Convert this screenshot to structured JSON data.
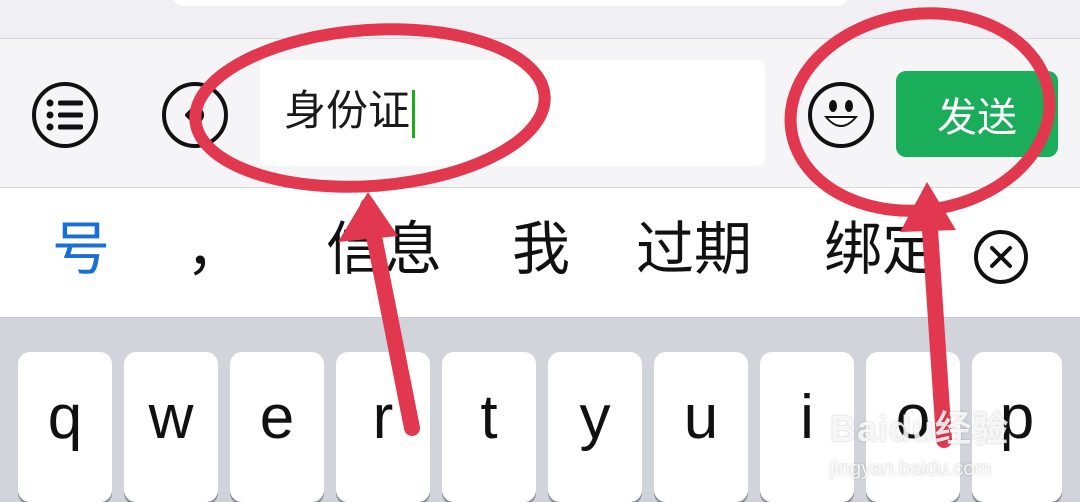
{
  "toolbar": {
    "input_value": "身份证",
    "send_label": "发送"
  },
  "candidates": [
    "号",
    "，",
    "信息",
    "我",
    "过期",
    "绑定"
  ],
  "keyboard": {
    "keys": [
      "q",
      "w",
      "e",
      "r",
      "t",
      "y",
      "u",
      "i",
      "o",
      "p"
    ]
  },
  "watermark": {
    "brand": "Baidu经验",
    "url": "jingyan.baidu.com"
  },
  "colors": {
    "send": "#1aad5a",
    "annotation": "#e2384f",
    "first_candidate": "#1a6fd6"
  }
}
